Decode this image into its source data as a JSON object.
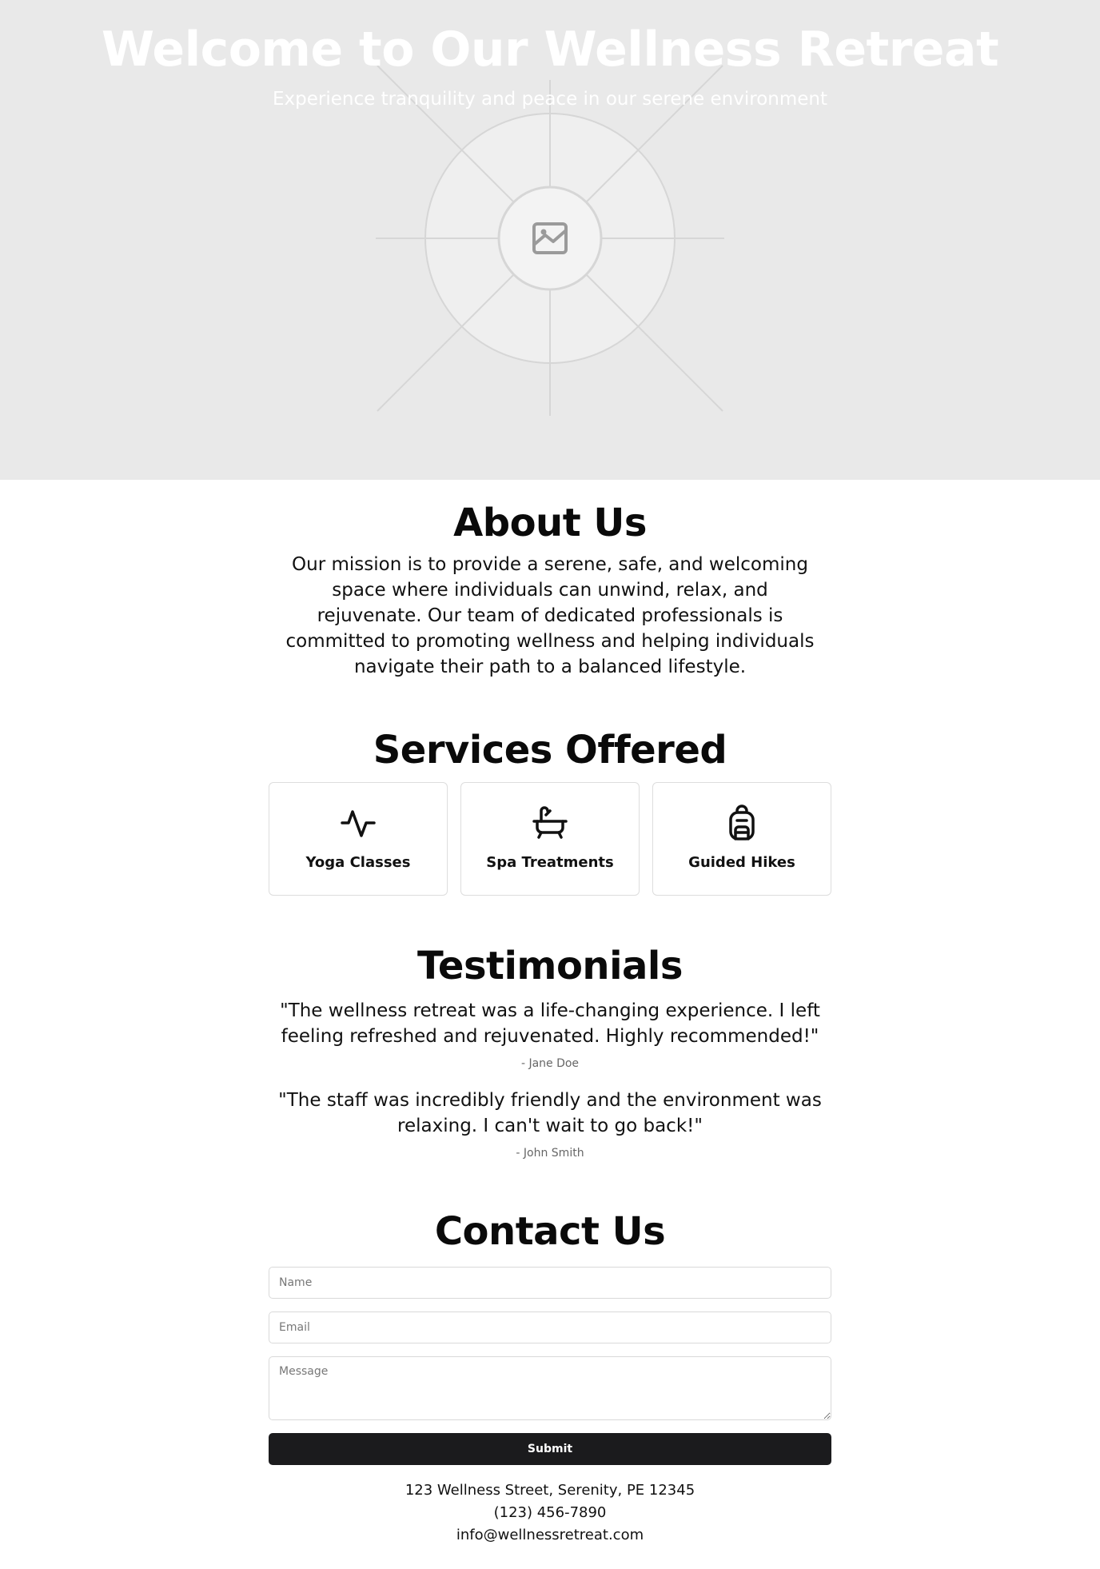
{
  "hero": {
    "title": "Welcome to Our Wellness Retreat",
    "subtitle": "Experience tranquility and peace in our serene environment",
    "image_icon": "image-placeholder-icon"
  },
  "about": {
    "title": "About Us",
    "text": "Our mission is to provide a serene, safe, and welcoming space where individuals can unwind, relax, and rejuvenate. Our team of dedicated professionals is committed to promoting wellness and helping individuals navigate their path to a balanced lifestyle."
  },
  "services": {
    "title": "Services Offered",
    "items": [
      {
        "label": "Yoga Classes",
        "icon": "activity-icon"
      },
      {
        "label": "Spa Treatments",
        "icon": "bath-icon"
      },
      {
        "label": "Guided Hikes",
        "icon": "backpack-icon"
      }
    ]
  },
  "testimonials": {
    "title": "Testimonials",
    "items": [
      {
        "quote": "\"The wellness retreat was a life-changing experience. I left feeling refreshed and rejuvenated. Highly recommended!\"",
        "author": "- Jane Doe"
      },
      {
        "quote": "\"The staff was incredibly friendly and the environment was relaxing. I can't wait to go back!\"",
        "author": "- John Smith"
      }
    ]
  },
  "contact": {
    "title": "Contact Us",
    "name_placeholder": "Name",
    "email_placeholder": "Email",
    "message_placeholder": "Message",
    "submit_label": "Submit",
    "address": "123 Wellness Street, Serenity, PE 12345",
    "phone": "(123) 456-7890",
    "email": "info@wellnessretreat.com"
  },
  "colors": {
    "hero_background": "#e9e9e9",
    "button_background": "#1b1b1d",
    "text": "#111111",
    "muted_text": "#666666"
  }
}
